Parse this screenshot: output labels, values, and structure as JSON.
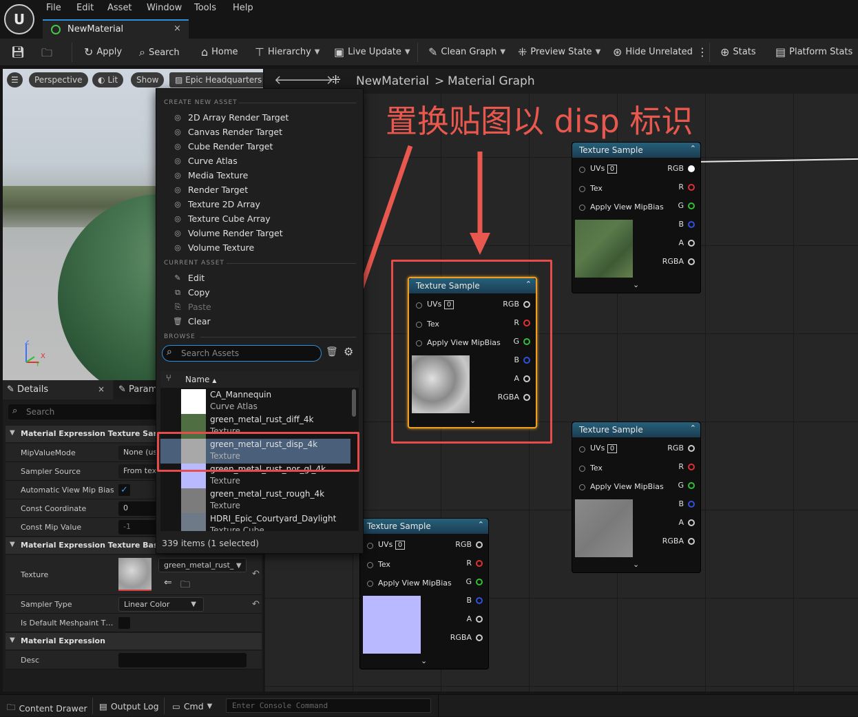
{
  "app": {
    "logo_text": "U",
    "menu": [
      "File",
      "Edit",
      "Asset",
      "Window",
      "Tools",
      "Help"
    ],
    "document_tab": "NewMaterial",
    "tab_close": "×"
  },
  "toolbar": {
    "apply": "Apply",
    "search": "Search",
    "home": "Home",
    "hierarchy": "Hierarchy",
    "live_update": "Live Update",
    "clean_graph": "Clean Graph",
    "preview_state": "Preview State",
    "hide_unrelated": "Hide Unrelated",
    "stats": "Stats",
    "platform_stats": "Platform Stats"
  },
  "viewport": {
    "perspective": "Perspective",
    "lit": "Lit",
    "show": "Show",
    "preview_scene": "Epic Headquarters",
    "axis_z": "Z",
    "axis_x": "X",
    "axis_y": "Y"
  },
  "graph": {
    "breadcrumb_root": "NewMaterial",
    "breadcrumb_sep": ">",
    "breadcrumb_page": "Material Graph"
  },
  "annotation": {
    "text": "置换贴图以 disp 标识"
  },
  "asset_menu": {
    "create_header": "CREATE NEW ASSET",
    "create_items": [
      "2D Array Render Target",
      "Canvas Render Target",
      "Cube Render Target",
      "Curve Atlas",
      "Media Texture",
      "Render Target",
      "Texture 2D Array",
      "Texture Cube Array",
      "Volume Render Target",
      "Volume Texture"
    ],
    "current_header": "CURRENT ASSET",
    "current_items": [
      {
        "label": "Edit",
        "disabled": false
      },
      {
        "label": "Copy",
        "disabled": false
      },
      {
        "label": "Paste",
        "disabled": true
      },
      {
        "label": "Clear",
        "disabled": false
      }
    ],
    "browse_header": "BROWSE",
    "search_placeholder": "Search Assets",
    "column_name": "Name",
    "sort_arrow": "▲",
    "assets": [
      {
        "name": "CA_Mannequin",
        "type": "Curve Atlas",
        "thumb": "#ffffff",
        "selected": false
      },
      {
        "name": "green_metal_rust_diff_4k",
        "type": "Texture",
        "thumb": "#4f6f43",
        "selected": false
      },
      {
        "name": "green_metal_rust_disp_4k",
        "type": "Texture",
        "thumb": "#a8a8a8",
        "selected": true
      },
      {
        "name": "green_metal_rust_nor_gl_4k",
        "type": "Texture",
        "thumb": "#b9b9ff",
        "selected": false
      },
      {
        "name": "green_metal_rust_rough_4k",
        "type": "Texture",
        "thumb": "#7c7c7c",
        "selected": false
      },
      {
        "name": "HDRI_Epic_Courtyard_Daylight",
        "type": "Texture Cube",
        "thumb": "#6e7a88",
        "selected": false
      }
    ],
    "item_count": "339 items (1 selected)"
  },
  "node_common": {
    "title": "Texture Sample",
    "uvs": "UVs",
    "uv_index": "0",
    "tex": "Tex",
    "apply_mip": "Apply View MipBias",
    "rgb": "RGB",
    "r": "R",
    "g": "G",
    "b": "B",
    "a": "A",
    "rgba": "RGBA"
  },
  "details": {
    "tab_details": "Details",
    "tab_params": "Param",
    "tab_close": "×",
    "search_placeholder": "Search",
    "cat_texture_sample": "Material Expression Texture Sample",
    "mip_value_mode_label": "MipValueMode",
    "mip_value_mode_value": "None (use",
    "sampler_source_label": "Sampler Source",
    "sampler_source_value": "From text",
    "auto_mip_bias_label": "Automatic View Mip Bias",
    "const_coord_label": "Const Coordinate",
    "const_coord_value": "0",
    "const_mip_label": "Const Mip Value",
    "const_mip_value": "-1",
    "cat_texture_base": "Material Expression Texture Base",
    "texture_label": "Texture",
    "texture_value": "green_metal_rust_",
    "sampler_type_label": "Sampler Type",
    "sampler_type_value": "Linear Color",
    "default_meshpaint_label": "Is Default Meshpaint T…",
    "cat_expression": "Material Expression",
    "desc_label": "Desc",
    "desc_value": ""
  },
  "bottom": {
    "content_drawer": "Content Drawer",
    "output_log": "Output Log",
    "cmd": "Cmd",
    "console_placeholder": "Enter Console Command"
  },
  "colors": {
    "accent": "#2f8fd8",
    "annotation_red": "#e74c4c",
    "node_header": "#25607a",
    "selected_node_border": "#f0a020"
  }
}
